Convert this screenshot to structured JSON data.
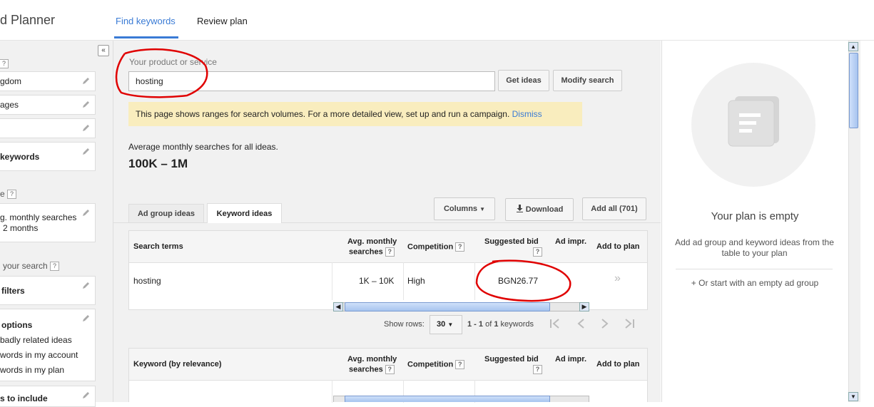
{
  "header": {
    "app_title": "d Planner",
    "tabs": [
      {
        "label": "Find keywords"
      },
      {
        "label": "Review plan"
      }
    ]
  },
  "sidebar": {
    "collapse_glyph": "«",
    "items": [
      {
        "label": "gdom"
      },
      {
        "label": "ages"
      },
      {
        "label": ""
      },
      {
        "label": "keywords"
      },
      {
        "label_line1": "g. monthly searches",
        "label_line2": "2 months"
      },
      {
        "label": "filters"
      },
      {
        "label": "options",
        "opt1": "badly related ideas",
        "opt2": "words in my account",
        "opt3": "words in my plan"
      },
      {
        "label": "s to include"
      }
    ],
    "section_e": "e",
    "section_search": "your search",
    "help": "?"
  },
  "search": {
    "label": "Your product or service",
    "value": "hosting",
    "get_ideas": "Get ideas",
    "modify_search": "Modify search"
  },
  "notice": {
    "text": "This page shows ranges for search volumes. For a more detailed view, set up and run a campaign.",
    "dismiss": "Dismiss"
  },
  "summary": {
    "label": "Average monthly searches for all ideas.",
    "value": "100K – 1M"
  },
  "idea_tabs": {
    "ad_group": "Ad group ideas",
    "keyword": "Keyword ideas"
  },
  "toolbar": {
    "columns": "Columns",
    "download": "Download",
    "add_all": "Add all (701)"
  },
  "table1": {
    "headers": {
      "term": "Search terms",
      "avg1": "Avg. monthly",
      "avg2": "searches",
      "competition": "Competition",
      "bid": "Suggested bid",
      "impr": "Ad impr.",
      "add": "Add to plan"
    },
    "row": {
      "term": "hosting",
      "avg": "1K – 10K",
      "competition": "High",
      "bid": "BGN26.77",
      "add": "»"
    }
  },
  "pagination": {
    "show_rows": "Show rows:",
    "rows": "30",
    "range_a": "1 - 1",
    "of": "of",
    "total": "1",
    "unit": "keywords"
  },
  "table2": {
    "headers": {
      "term": "Keyword (by relevance)",
      "avg1": "Avg. monthly",
      "avg2": "searches",
      "competition": "Competition",
      "bid": "Suggested bid",
      "impr": "Ad impr.",
      "add": "Add to plan"
    }
  },
  "plan": {
    "empty_title": "Your plan is empty",
    "empty_desc": "Add ad group and keyword ideas from the table to your plan",
    "empty_link": "+ Or start with an empty ad group"
  },
  "colors": {
    "accent": "#3a7bd5",
    "annotation": "#e00000",
    "notice_bg": "#f9edbe"
  }
}
